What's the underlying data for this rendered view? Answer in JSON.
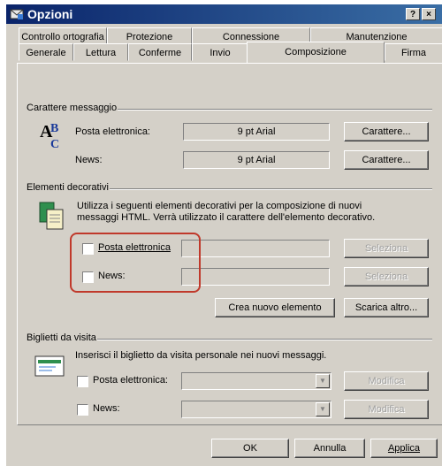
{
  "window": {
    "title": "Opzioni",
    "help_label": "?",
    "close_label": "×"
  },
  "tabs": {
    "back": [
      "Controllo ortografia",
      "Protezione",
      "Connessione",
      "Manutenzione"
    ],
    "front": [
      "Generale",
      "Lettura",
      "Conferme",
      "Invio",
      "Composizione",
      "Firma"
    ],
    "active": "Composizione"
  },
  "font_group": {
    "title": "Carattere messaggio",
    "email_label": "Posta elettronica:",
    "email_value": "9 pt Arial",
    "email_button": "Carattere...",
    "news_label": "News:",
    "news_value": "9 pt Arial",
    "news_button": "Carattere..."
  },
  "stationery_group": {
    "title": "Elementi decorativi",
    "description_line1": "Utilizza i seguenti elementi decorativi per la composizione di nuovi",
    "description_line2": "messaggi HTML. Verrà utilizzato il carattere dell'elemento decorativo.",
    "email_label": "Posta elettronica",
    "email_select": "Seleziona",
    "news_label": "News:",
    "news_select": "Seleziona",
    "create_button": "Crea nuovo elemento",
    "download_button": "Scarica altro..."
  },
  "vcard_group": {
    "title": "Biglietti da visita",
    "description": "Inserisci il biglietto da visita personale nei nuovi messaggi.",
    "email_label": "Posta elettronica:",
    "email_edit": "Modifica",
    "news_label": "News:",
    "news_edit": "Modifica"
  },
  "footer": {
    "ok": "OK",
    "cancel": "Annulla",
    "apply": "Applica"
  },
  "colors": {
    "titlebar": "#0a246a",
    "face": "#d4d0c8",
    "highlight_ring": "#c0392b"
  }
}
